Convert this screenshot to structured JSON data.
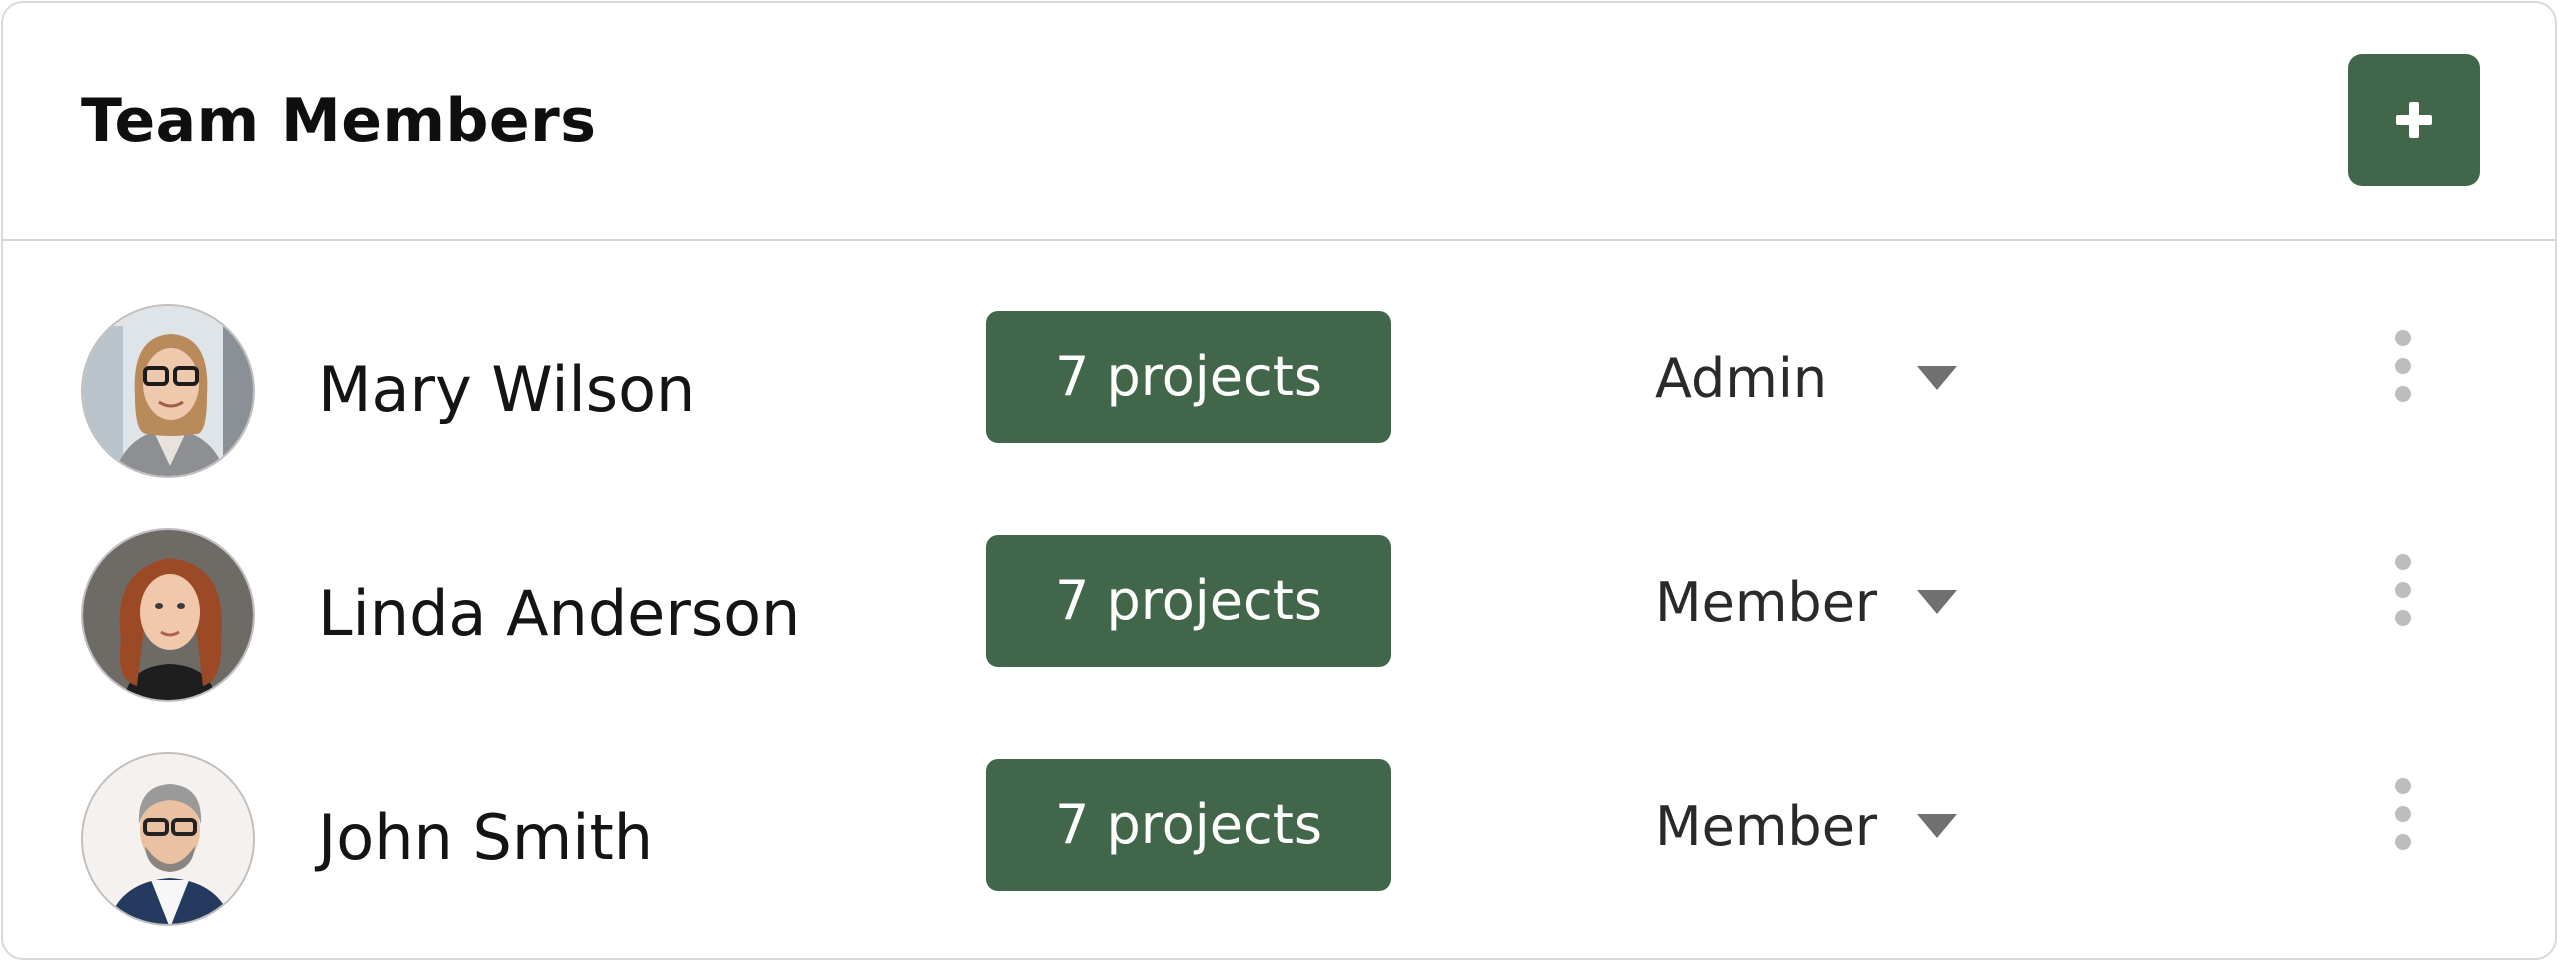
{
  "header": {
    "title": "Team Members",
    "add_icon": "plus-icon"
  },
  "colors": {
    "accent": "#426649",
    "divider": "#d6d6d6",
    "dots": "#bdbdbd",
    "chevron": "#707070"
  },
  "members": [
    {
      "name": "Mary Wilson",
      "projects": "7 projects",
      "role": "Admin"
    },
    {
      "name": "Linda Anderson",
      "projects": "7 projects",
      "role": "Member"
    },
    {
      "name": "John Smith",
      "projects": "7 projects",
      "role": "Member"
    }
  ],
  "icons": {
    "role_dropdown": "chevron-down-icon",
    "row_menu": "more-vertical-icon"
  }
}
